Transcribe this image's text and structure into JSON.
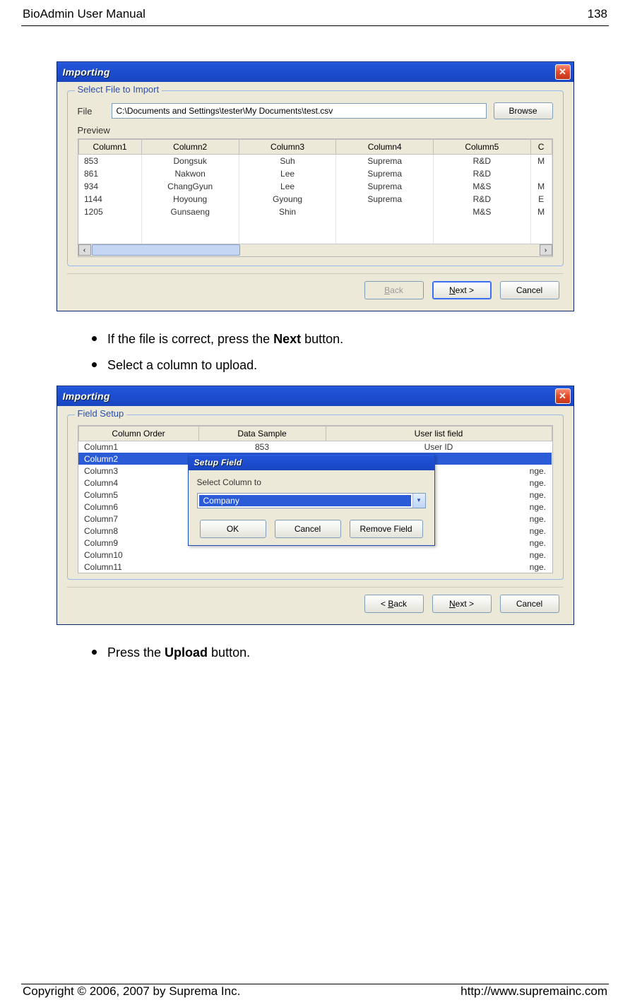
{
  "header": {
    "left": "BioAdmin User Manual",
    "right": "138"
  },
  "footer": {
    "left": "Copyright © 2006, 2007 by Suprema Inc.",
    "right": "http://www.supremainc.com"
  },
  "bullets": {
    "b1_pre": "If the file is correct, press the ",
    "b1_bold": "Next",
    "b1_post": " button.",
    "b2": "Select a column to upload.",
    "b3_pre": "Press the ",
    "b3_bold": "Upload",
    "b3_post": " button."
  },
  "dialog1": {
    "title": "Importing",
    "group": "Select File to Import",
    "file_label": "File",
    "file_value": "C:\\Documents and Settings\\tester\\My Documents\\test.csv",
    "browse": "Browse",
    "preview_label": "Preview",
    "headers": [
      "Column1",
      "Column2",
      "Column3",
      "Column4",
      "Column5",
      "C"
    ],
    "rows": [
      [
        "853",
        "Dongsuk",
        "Suh",
        "Suprema",
        "R&D",
        "M"
      ],
      [
        "861",
        "Nakwon",
        "Lee",
        "Suprema",
        "R&D",
        ""
      ],
      [
        "934",
        "ChangGyun",
        "Lee",
        "Suprema",
        "M&S",
        "M"
      ],
      [
        "1144",
        "Hoyoung",
        "Gyoung",
        "Suprema",
        "R&D",
        "E"
      ],
      [
        "1205",
        "Gunsaeng",
        "Shin",
        "",
        "M&S",
        "M"
      ]
    ],
    "buttons": {
      "back": "< Back",
      "next": "Next >",
      "cancel": "Cancel"
    }
  },
  "dialog2": {
    "title": "Importing",
    "group": "Field Setup",
    "headers": [
      "Column Order",
      "Data Sample",
      "User list field"
    ],
    "rows": [
      {
        "c": "Column1",
        "s": "853",
        "f": "User ID"
      },
      {
        "c": "Column2",
        "s": "",
        "f": "",
        "sel": true
      },
      {
        "c": "Column3",
        "s": "",
        "f": "nge."
      },
      {
        "c": "Column4",
        "s": "",
        "f": "nge."
      },
      {
        "c": "Column5",
        "s": "",
        "f": "nge."
      },
      {
        "c": "Column6",
        "s": "",
        "f": "nge."
      },
      {
        "c": "Column7",
        "s": "",
        "f": "nge."
      },
      {
        "c": "Column8",
        "s": "",
        "f": "nge."
      },
      {
        "c": "Column9",
        "s": "",
        "f": "nge."
      },
      {
        "c": "Column10",
        "s": "",
        "f": "nge."
      },
      {
        "c": "Column11",
        "s": "",
        "f": "nge."
      }
    ],
    "setup": {
      "title": "Setup Field",
      "label": "Select Column to",
      "value": "Company",
      "ok": "OK",
      "cancel": "Cancel",
      "remove": "Remove Field"
    },
    "buttons": {
      "back": "< Back",
      "next": "Next >",
      "cancel": "Cancel"
    }
  }
}
